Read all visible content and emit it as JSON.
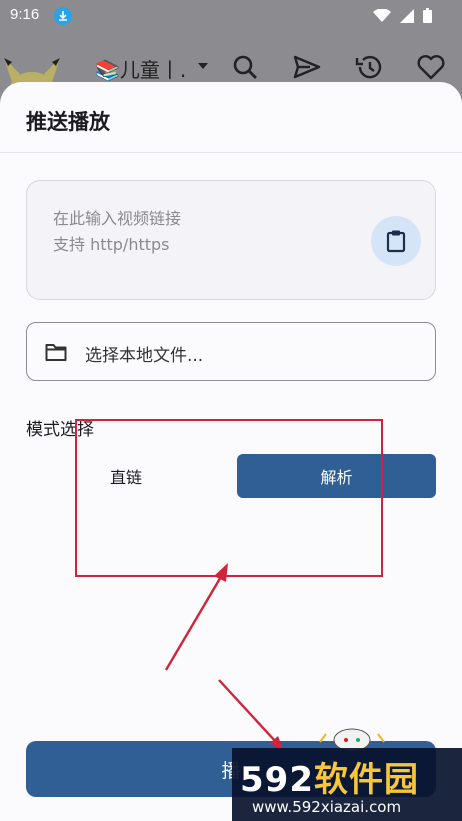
{
  "statusbar": {
    "time": "9:16"
  },
  "appbar": {
    "title": "📚儿童丨."
  },
  "sheet": {
    "title": "推送播放",
    "url_input": {
      "placeholder_line1": "在此输入视频链接",
      "placeholder_line2": "支持 http/https"
    },
    "file_picker": {
      "label": "选择本地文件..."
    },
    "mode": {
      "label": "模式选择",
      "options": [
        "直链",
        "解析"
      ],
      "selected": "解析"
    },
    "play_button": {
      "label": "播"
    }
  },
  "watermark": {
    "brand_num": "592",
    "brand_zh": "软件园",
    "url": "www.592xiazai.com"
  },
  "colors": {
    "accent": "#2f5f95",
    "annotation": "#d0243a",
    "paste_bg": "#d6e4f8"
  },
  "icons": [
    "download-icon",
    "wifi-icon",
    "signal-icon",
    "battery-icon",
    "search-icon",
    "send-icon",
    "history-icon",
    "heart-icon",
    "clipboard-icon",
    "folder-icon"
  ]
}
